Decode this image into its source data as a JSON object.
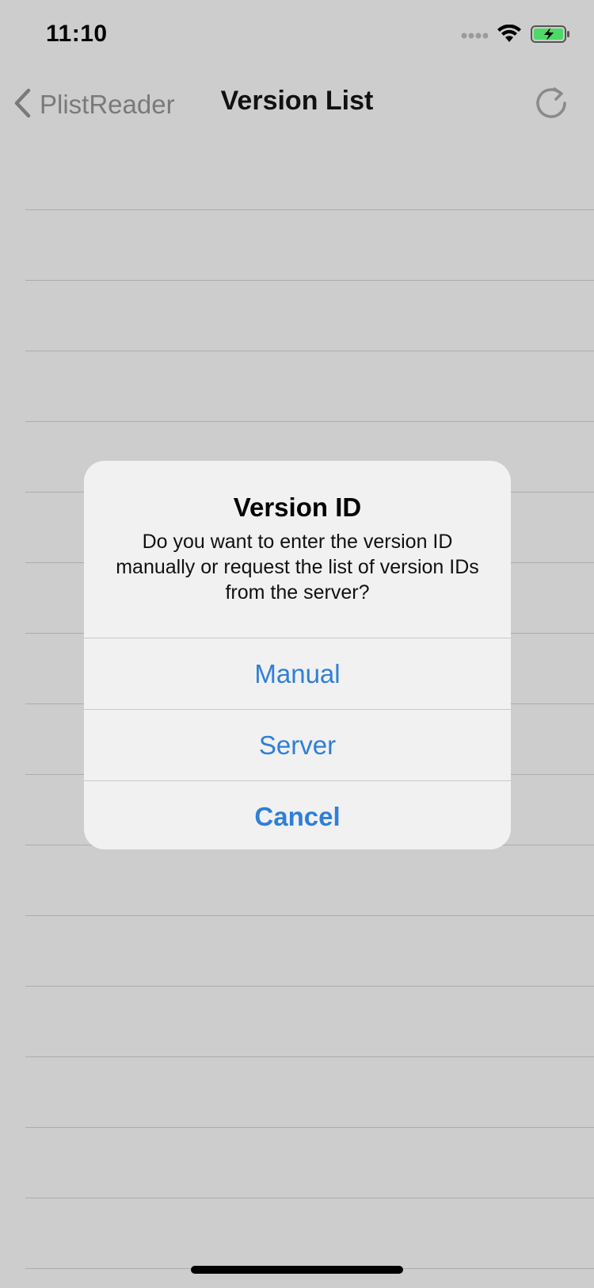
{
  "status_bar": {
    "time": "11:10",
    "icons": [
      "cellular-signal-icon",
      "wifi-icon",
      "battery-charging-icon"
    ]
  },
  "nav": {
    "back_label": "PlistReader",
    "title": "Version List",
    "refresh_icon": "refresh-icon"
  },
  "alert": {
    "title": "Version ID",
    "message": "Do you want to enter the version ID manually or request the list of version IDs from the server?",
    "actions": [
      {
        "label": "Manual"
      },
      {
        "label": "Server"
      },
      {
        "label": "Cancel"
      }
    ]
  },
  "colors": {
    "accent": "#2f7fd8",
    "backdrop": "#cdcdcd",
    "alert_background": "#f1f1f1",
    "battery_green": "#4cd964"
  }
}
